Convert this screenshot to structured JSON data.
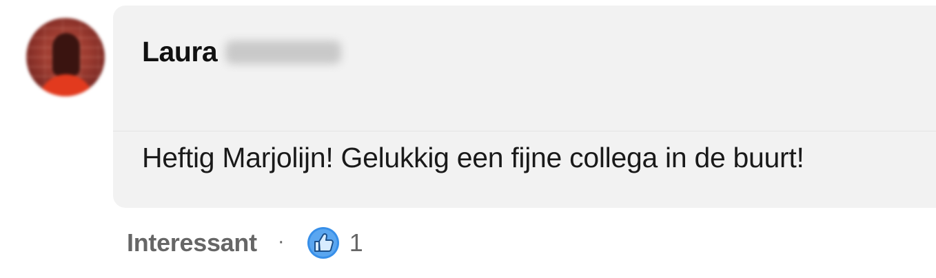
{
  "comment": {
    "author_first_name": "Laura",
    "text": "Heftig Marjolijn! Gelukkig een fijne collega in de buurt!"
  },
  "actions": {
    "react_label": "Interessant",
    "separator": "·",
    "reaction_icon": "thumbs-up-icon",
    "reaction_count": "1"
  },
  "colors": {
    "bubble_bg": "#f2f2f2",
    "reaction_blue": "#378fe9",
    "muted_text": "#666666"
  }
}
